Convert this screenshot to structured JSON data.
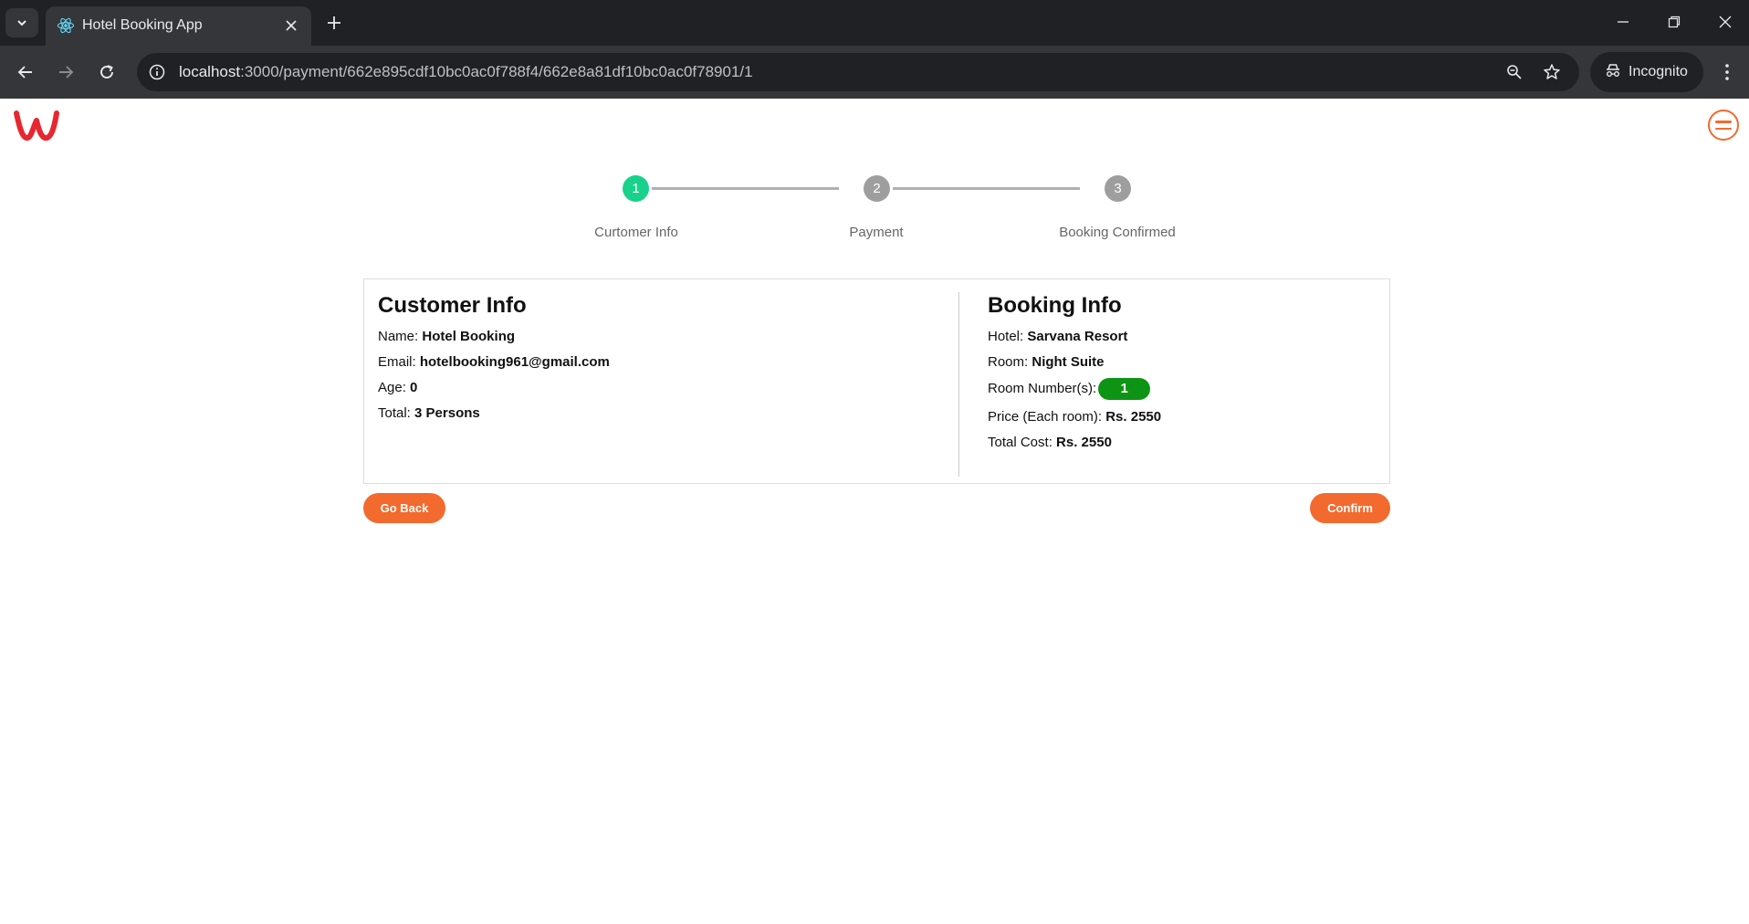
{
  "browser": {
    "tab_title": "Hotel Booking App",
    "url_host": "localhost",
    "url_path": ":3000/payment/662e895cdf10bc0ac0f788f4/662e8a81df10bc0ac0f78901/1",
    "incognito_label": "Incognito",
    "icons": [
      "tab-search-icon",
      "react-favicon-icon",
      "close-icon",
      "plus-icon",
      "minimize-icon",
      "restore-icon",
      "window-close-icon",
      "back-arrow-icon",
      "forward-arrow-icon",
      "reload-icon",
      "site-info-icon",
      "zoom-icon",
      "star-icon",
      "incognito-icon",
      "more-vert-icon"
    ]
  },
  "header": {
    "logo_icon": "w-logo-icon",
    "menu_icon": "hamburger-menu-icon",
    "accent_color": "#f26a2e",
    "logo_color": "#e8262f"
  },
  "stepper": {
    "active_step": 1,
    "active_color": "#18d28c",
    "inactive_color": "#9e9e9e",
    "steps": [
      {
        "number": "1",
        "label": "Curtomer Info"
      },
      {
        "number": "2",
        "label": "Payment"
      },
      {
        "number": "3",
        "label": "Booking Confirmed"
      }
    ]
  },
  "customer": {
    "title": "Customer Info",
    "name_label": "Name:",
    "name_value": "Hotel Booking",
    "email_label": "Email:",
    "email_value": "hotelbooking961@gmail.com",
    "age_label": "Age:",
    "age_value": "0",
    "total_label": "Total:",
    "total_value": "3 Persons"
  },
  "booking": {
    "title": "Booking Info",
    "hotel_label": "Hotel:",
    "hotel_value": "Sarvana Resort",
    "room_label": "Room:",
    "room_value": "Night Suite",
    "room_numbers_label": "Room Number(s):",
    "room_numbers": [
      "1"
    ],
    "badge_color": "#0e9414",
    "price_label": "Price (Each room):",
    "price_value": "Rs. 2550",
    "total_cost_label": "Total Cost:",
    "total_cost_value": "Rs. 2550"
  },
  "actions": {
    "back_label": "Go Back",
    "confirm_label": "Confirm"
  }
}
